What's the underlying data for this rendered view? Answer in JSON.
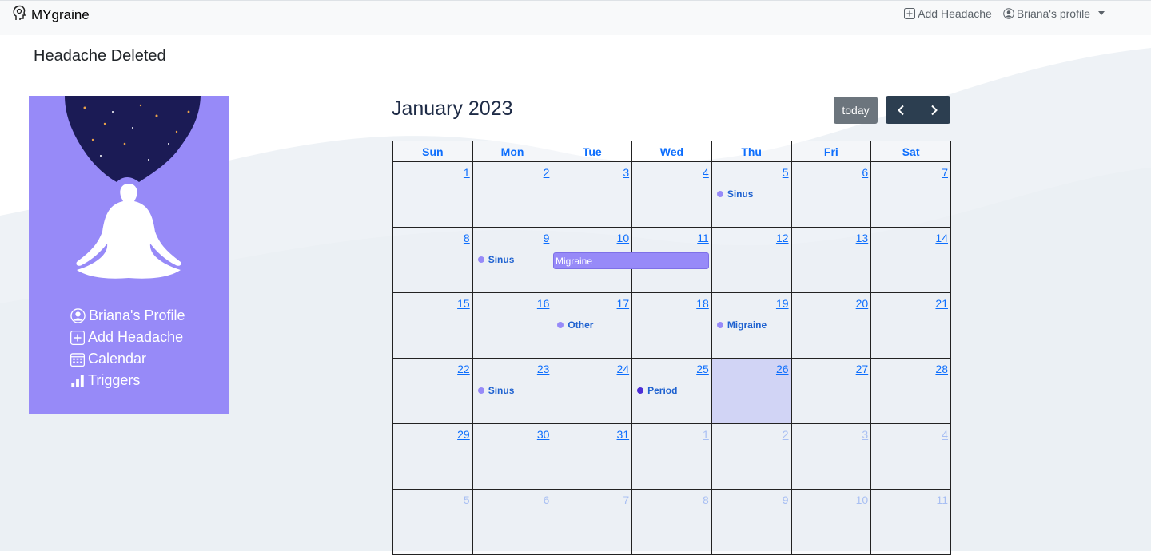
{
  "navbar": {
    "brand": "MYgraine",
    "add_headache": "Add Headache",
    "profile": "Briana's profile"
  },
  "alert": "Headache Deleted",
  "sidebar": {
    "items": [
      {
        "label": "Briana's Profile",
        "icon": "user-circle-icon"
      },
      {
        "label": "Add Headache",
        "icon": "plus-square-icon"
      },
      {
        "label": "Calendar",
        "icon": "calendar-icon"
      },
      {
        "label": "Triggers",
        "icon": "bar-chart-icon"
      }
    ]
  },
  "calendar": {
    "title": "January 2023",
    "today_label": "today",
    "weekdays": [
      "Sun",
      "Mon",
      "Tue",
      "Wed",
      "Thu",
      "Fri",
      "Sat"
    ],
    "weeks": [
      [
        {
          "d": "1"
        },
        {
          "d": "2"
        },
        {
          "d": "3"
        },
        {
          "d": "4"
        },
        {
          "d": "5",
          "event": "Sinus"
        },
        {
          "d": "6"
        },
        {
          "d": "7"
        }
      ],
      [
        {
          "d": "8"
        },
        {
          "d": "9",
          "event": "Sinus"
        },
        {
          "d": "10"
        },
        {
          "d": "11"
        },
        {
          "d": "12"
        },
        {
          "d": "13"
        },
        {
          "d": "14"
        }
      ],
      [
        {
          "d": "15"
        },
        {
          "d": "16"
        },
        {
          "d": "17",
          "event": "Other"
        },
        {
          "d": "18"
        },
        {
          "d": "19",
          "event": "Migraine"
        },
        {
          "d": "20"
        },
        {
          "d": "21"
        }
      ],
      [
        {
          "d": "22"
        },
        {
          "d": "23",
          "event": "Sinus"
        },
        {
          "d": "24"
        },
        {
          "d": "25",
          "event": "Period",
          "dark": true
        },
        {
          "d": "26",
          "today": true
        },
        {
          "d": "27"
        },
        {
          "d": "28"
        }
      ],
      [
        {
          "d": "29"
        },
        {
          "d": "30"
        },
        {
          "d": "31"
        },
        {
          "d": "1",
          "other": true
        },
        {
          "d": "2",
          "other": true
        },
        {
          "d": "3",
          "other": true
        },
        {
          "d": "4",
          "other": true
        }
      ],
      [
        {
          "d": "5",
          "other": true
        },
        {
          "d": "6",
          "other": true
        },
        {
          "d": "7",
          "other": true
        },
        {
          "d": "8",
          "other": true
        },
        {
          "d": "9",
          "other": true
        },
        {
          "d": "10",
          "other": true
        },
        {
          "d": "11",
          "other": true
        }
      ]
    ],
    "multi_day_event": {
      "label": "Migraine",
      "start": "10",
      "end": "11"
    }
  },
  "colors": {
    "accent": "#978af8",
    "navy": "#2c3e50",
    "link": "#0d6efd"
  }
}
